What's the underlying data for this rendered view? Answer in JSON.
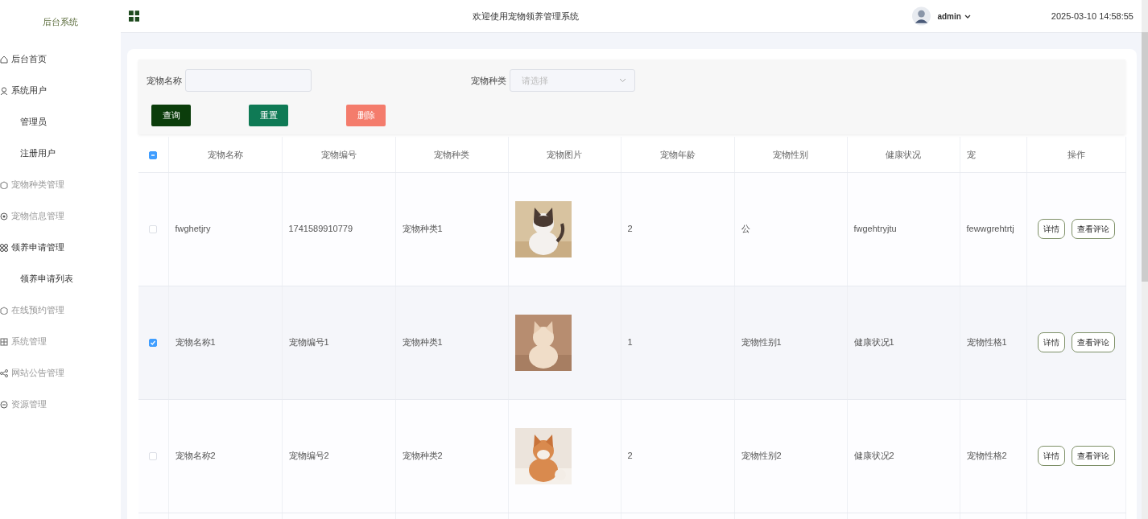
{
  "sidebar": {
    "title": "后台系统",
    "items": [
      {
        "label": "后台首页",
        "muted": false
      },
      {
        "label": "系统用户",
        "muted": false,
        "children": [
          {
            "label": "管理员",
            "muted": false
          },
          {
            "label": "注册用户",
            "muted": false
          }
        ]
      },
      {
        "label": "宠物种类管理",
        "muted": true
      },
      {
        "label": "宠物信息管理",
        "muted": true
      },
      {
        "label": "领养申请管理",
        "muted": false,
        "children": [
          {
            "label": "领养申请列表",
            "muted": false
          }
        ]
      },
      {
        "label": "在线预约管理",
        "muted": true
      },
      {
        "label": "系统管理",
        "muted": true
      },
      {
        "label": "网站公告管理",
        "muted": true
      },
      {
        "label": "资源管理",
        "muted": true
      }
    ]
  },
  "header": {
    "title": "欢迎使用宠物领养管理系统",
    "user": "admin",
    "datetime": "2025-03-10 14:58:55"
  },
  "search": {
    "fields": [
      {
        "label": "宠物名称",
        "kind": "text"
      },
      {
        "label": "宠物种类",
        "kind": "select",
        "placeholder": "请选择"
      }
    ],
    "buttons": [
      {
        "label": "查询",
        "kind": "search"
      },
      {
        "label": "重置",
        "kind": "reset"
      },
      {
        "label": "删除",
        "kind": "delete"
      }
    ]
  },
  "table": {
    "select_all_indeterminate": true,
    "columns": [
      "宠物名称",
      "宠物编号",
      "宠物种类",
      "宠物图片",
      "宠物年龄",
      "宠物性别",
      "健康状况",
      "宠",
      "操作"
    ],
    "rows": [
      {
        "selected": false,
        "cells": [
          "fwghetjry",
          "1741589910779",
          "宠物种类1",
          "",
          "2",
          "公",
          "fwgehtryjtu",
          "fewwgrehtrtj"
        ],
        "actions": [
          "详情",
          "查看评论"
        ]
      },
      {
        "selected": true,
        "cells": [
          "宠物名称1",
          "宠物编号1",
          "宠物种类1",
          "",
          "1",
          "宠物性别1",
          "健康状况1",
          "宠物性格1"
        ],
        "actions": [
          "详情",
          "查看评论"
        ]
      },
      {
        "selected": false,
        "cells": [
          "宠物名称2",
          "宠物编号2",
          "宠物种类2",
          "",
          "2",
          "宠物性别2",
          "健康状况2",
          "宠物性格2"
        ],
        "actions": [
          "详情",
          "查看评论"
        ]
      }
    ]
  }
}
